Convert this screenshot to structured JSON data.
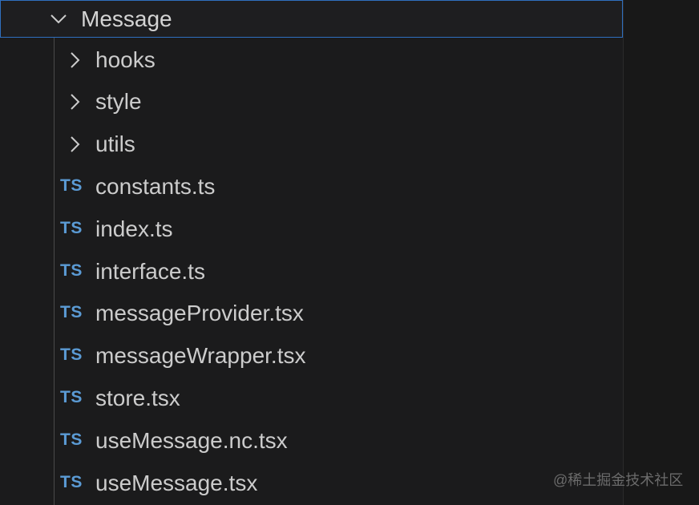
{
  "explorer": {
    "open_folder": {
      "label": "Message",
      "expanded": true,
      "icon": "chevron-down-icon"
    },
    "items": [
      {
        "type": "folder",
        "label": "hooks",
        "icon": "chevron-right-icon"
      },
      {
        "type": "folder",
        "label": "style",
        "icon": "chevron-right-icon"
      },
      {
        "type": "folder",
        "label": "utils",
        "icon": "chevron-right-icon"
      },
      {
        "type": "file",
        "label": "constants.ts",
        "icon": "typescript-file-icon",
        "icon_text": "TS"
      },
      {
        "type": "file",
        "label": "index.ts",
        "icon": "typescript-file-icon",
        "icon_text": "TS"
      },
      {
        "type": "file",
        "label": "interface.ts",
        "icon": "typescript-file-icon",
        "icon_text": "TS"
      },
      {
        "type": "file",
        "label": "messageProvider.tsx",
        "icon": "typescript-file-icon",
        "icon_text": "TS"
      },
      {
        "type": "file",
        "label": "messageWrapper.tsx",
        "icon": "typescript-file-icon",
        "icon_text": "TS"
      },
      {
        "type": "file",
        "label": "store.tsx",
        "icon": "typescript-file-icon",
        "icon_text": "TS"
      },
      {
        "type": "file",
        "label": "useMessage.nc.tsx",
        "icon": "typescript-file-icon",
        "icon_text": "TS"
      },
      {
        "type": "file",
        "label": "useMessage.tsx",
        "icon": "typescript-file-icon",
        "icon_text": "TS"
      }
    ]
  },
  "watermark": "@稀土掘金技术社区",
  "colors": {
    "background": "#1b1b1c",
    "focus_border": "#2f6fbf",
    "ts_icon": "#5b9bd5",
    "text": "#cccccc"
  }
}
